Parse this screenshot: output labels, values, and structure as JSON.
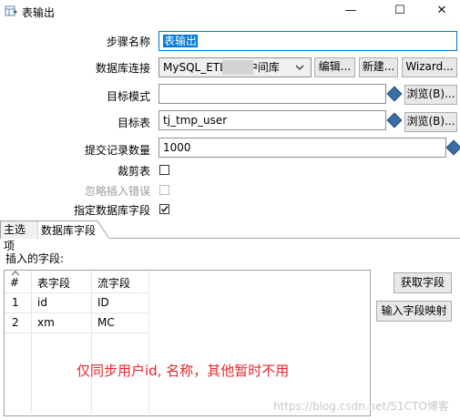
{
  "window": {
    "title": "表输出",
    "minimize": "—",
    "maximize": "☐",
    "close": "✕"
  },
  "form": {
    "step_name_label": "步骤名称",
    "step_name_value": "表输出",
    "db_conn_label": "数据库连接",
    "db_conn_value": "MySQL_ETL      中间库",
    "edit_btn": "编辑...",
    "new_btn": "新建...",
    "wizard_btn": "Wizard...",
    "target_schema_label": "目标模式",
    "target_schema_value": "",
    "browse_btn": "浏览(B)...",
    "target_table_label": "目标表",
    "target_table_value": "tj_tmp_user",
    "browse_btn2": "浏览(B)...",
    "commit_label": "提交记录数量",
    "commit_value": "1000",
    "truncate_label": "裁剪表",
    "ignore_errors_label": "忽略插入错误",
    "specify_fields_label": "指定数据库字段"
  },
  "tabs": {
    "main": "主选项",
    "db_fields": "数据库字段"
  },
  "fields_panel": {
    "label": "插入的字段:",
    "columns": [
      "#",
      "表字段",
      "流字段"
    ],
    "rows": [
      {
        "num": "1",
        "table_field": "id",
        "stream_field": "ID"
      },
      {
        "num": "2",
        "table_field": "xm",
        "stream_field": "MC"
      }
    ],
    "get_fields_btn": "获取字段",
    "mapping_btn": "输入字段映射"
  },
  "annotation": "仅同步用户id, 名称，其他暂时不用",
  "watermark": "https://blog.csdn.net/51CTO博客",
  "colors": {
    "selection": "#0078d7",
    "annotation": "#e8262a"
  }
}
